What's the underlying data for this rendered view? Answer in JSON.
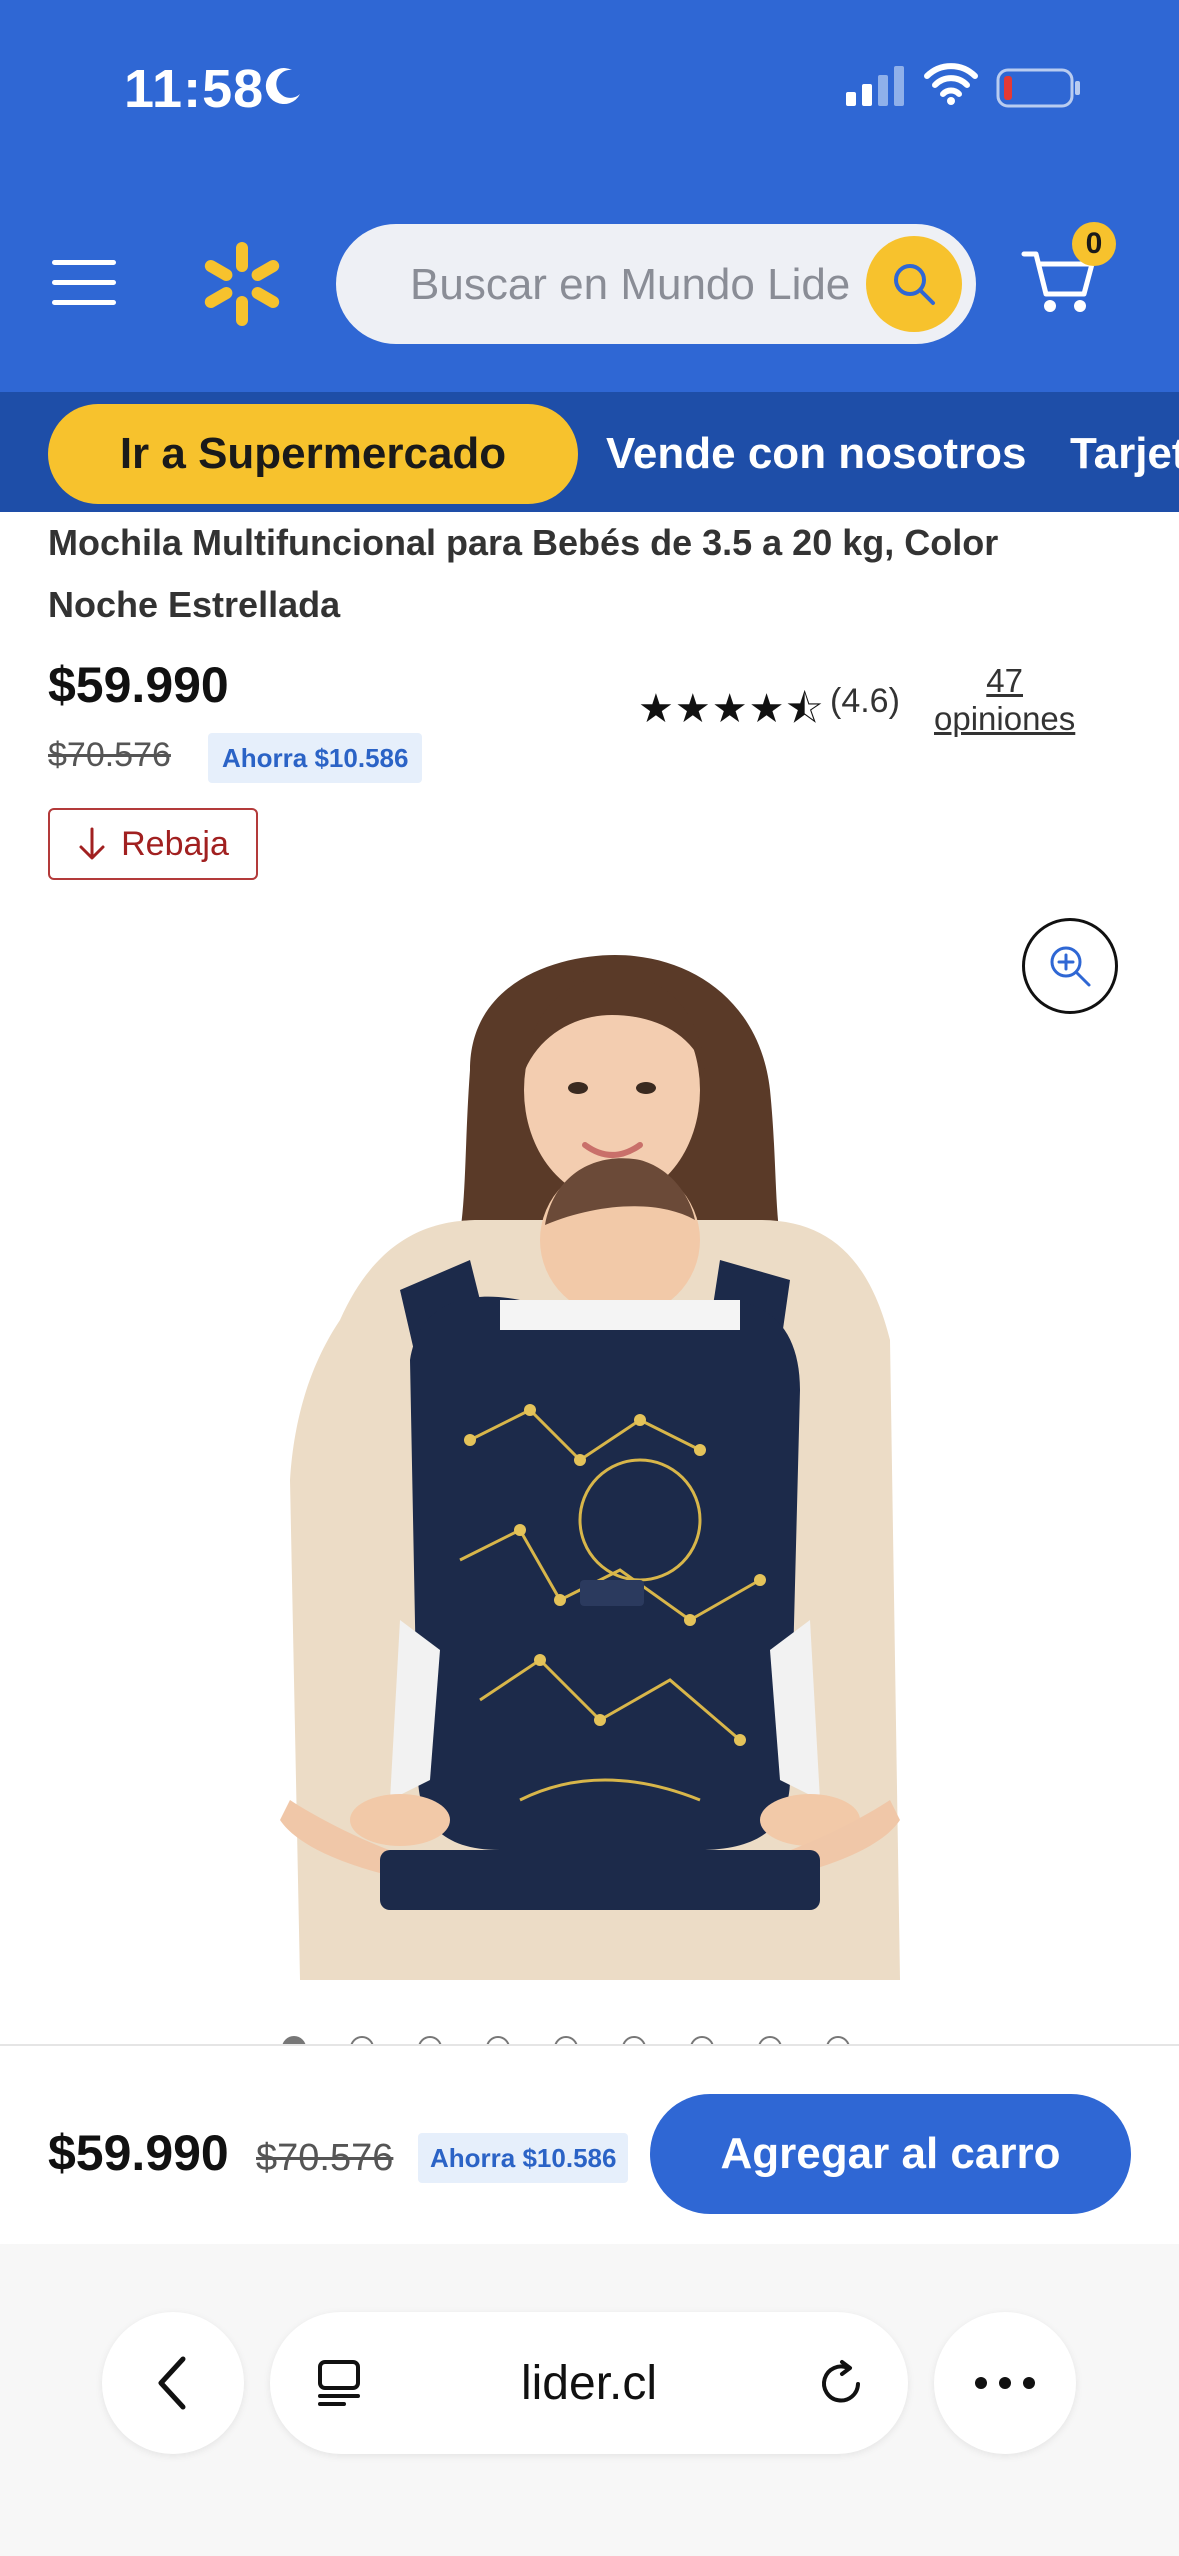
{
  "status_bar": {
    "time": "11:58"
  },
  "header": {
    "search_placeholder": "Buscar en Mundo Lider",
    "cart_count": "0",
    "brand_color": "#2f67d4",
    "accent_color": "#f7c22d"
  },
  "nav": {
    "supermarket": "Ir a Supermercado",
    "sell": "Vende con nosotros",
    "cards": "Tarjeta"
  },
  "product": {
    "title": "Mochila Multifuncional para Bebés de 3.5 a 20 kg, Color Noche Estrellada",
    "price": "$59.990",
    "old_price": "$70.576",
    "savings": "Ahorra $10.586",
    "stars": "★★★★⯪",
    "rating": "(4.6)",
    "reviews_count": "47",
    "reviews_label": "opiniones",
    "badge": "Rebaja",
    "carousel_images": 9,
    "carousel_active": 1
  },
  "bottom_bar": {
    "price": "$59.990",
    "old_price": "$70.576",
    "savings": "Ahorra $10.586",
    "add_to_cart": "Agregar al carro"
  },
  "browser": {
    "url": "lider.cl"
  }
}
